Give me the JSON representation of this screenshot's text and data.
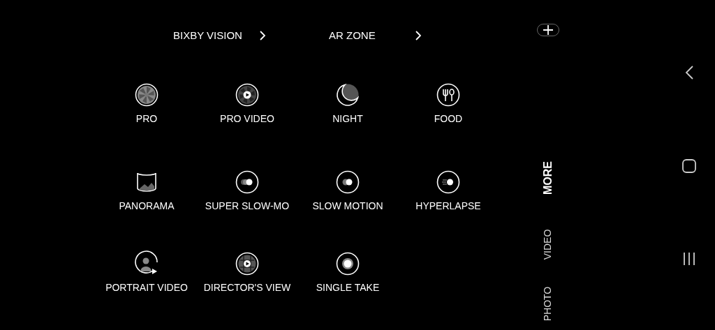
{
  "top_links": [
    {
      "label": "BIXBY VISION"
    },
    {
      "label": "AR ZONE"
    }
  ],
  "modes": [
    {
      "label": "PRO"
    },
    {
      "label": "PRO VIDEO"
    },
    {
      "label": "NIGHT"
    },
    {
      "label": "FOOD"
    },
    {
      "label": "PANORAMA"
    },
    {
      "label": "SUPER SLOW-MO"
    },
    {
      "label": "SLOW MOTION"
    },
    {
      "label": "HYPERLAPSE"
    },
    {
      "label": "PORTRAIT VIDEO"
    },
    {
      "label": "DIRECTOR'S VIEW"
    },
    {
      "label": "SINGLE TAKE"
    }
  ],
  "mode_tabs": [
    {
      "label": "MORE",
      "selected": true
    },
    {
      "label": "VIDEO",
      "selected": false
    },
    {
      "label": "PHOTO",
      "selected": false
    }
  ]
}
